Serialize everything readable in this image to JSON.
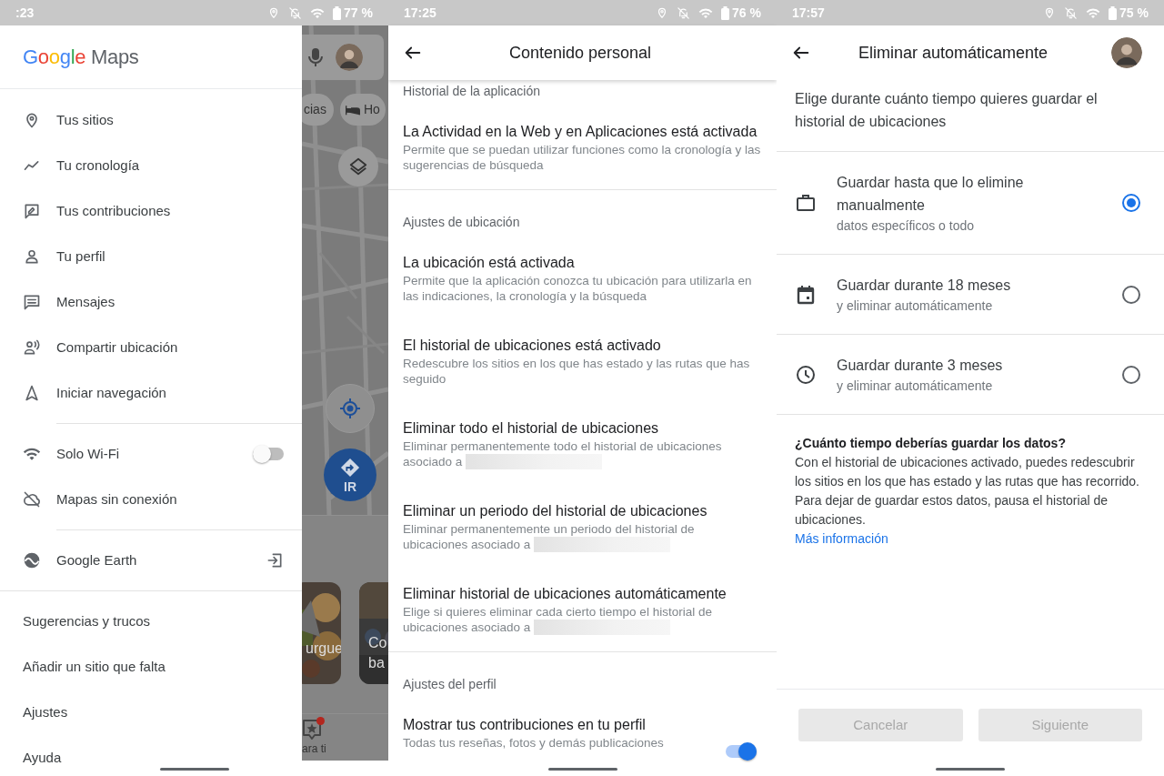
{
  "maps_drawer": {
    "status_bar": {
      "time": ":23",
      "battery": "77 %"
    },
    "logo": {
      "brand": "Google",
      "product": "Maps"
    },
    "groups": [
      {
        "kind": "icons",
        "items": [
          {
            "kind": "link",
            "label": "Tus sitios"
          },
          {
            "kind": "link",
            "label": "Tu cronología"
          },
          {
            "kind": "link",
            "label": "Tus contribuciones"
          },
          {
            "kind": "link",
            "label": "Tu perfil"
          },
          {
            "kind": "link",
            "label": "Mensajes"
          },
          {
            "kind": "link",
            "label": "Compartir ubicación"
          },
          {
            "kind": "link",
            "label": "Iniciar navegación"
          }
        ]
      },
      {
        "kind": "icons",
        "items": [
          {
            "kind": "toggle",
            "label": "Solo Wi-Fi",
            "on": false
          },
          {
            "kind": "link",
            "label": "Mapas sin conexión"
          }
        ]
      },
      {
        "kind": "icons",
        "items": [
          {
            "kind": "external",
            "label": "Google Earth"
          }
        ]
      },
      {
        "kind": "plain",
        "items": [
          {
            "kind": "link",
            "label": "Sugerencias y trucos"
          },
          {
            "kind": "link",
            "label": "Añadir un sitio que falta"
          },
          {
            "kind": "link",
            "label": "Ajustes"
          },
          {
            "kind": "link",
            "label": "Ayuda"
          }
        ]
      }
    ],
    "map": {
      "chips": [
        {
          "label": "cias"
        },
        {
          "label": "Ho"
        }
      ],
      "go_button": "IR",
      "cards": [
        {
          "title": "urgue"
        },
        {
          "title": "Co ba"
        }
      ],
      "nav_label": "ara ti"
    }
  },
  "personal_content": {
    "status_bar": {
      "time": "17:25",
      "battery": "76 %"
    },
    "title": "Contenido personal",
    "sections": [
      {
        "heading": "Historial de la aplicación",
        "items": [
          {
            "kind": "link",
            "title": "La Actividad en la Web y en Aplicaciones está activada",
            "description": "Permite que se puedan utilizar funciones como la cronología y las sugerencias de búsqueda",
            "redacted": false
          }
        ]
      },
      {
        "heading": "Ajustes de ubicación",
        "items": [
          {
            "kind": "link",
            "title": "La ubicación está activada",
            "description": "Permite que la aplicación conozca tu ubicación para utilizarla en las indicaciones, la cronología y la búsqueda",
            "redacted": false
          },
          {
            "kind": "link",
            "title": "El historial de ubicaciones está activado",
            "description": "Redescubre los sitios en los que has estado y las rutas que has seguido",
            "redacted": false
          },
          {
            "kind": "link",
            "title": "Eliminar todo el historial de ubicaciones",
            "description": "Eliminar permanentemente todo el historial de ubicaciones asociado a",
            "redacted": true
          },
          {
            "kind": "link",
            "title": "Eliminar un periodo del historial de ubicaciones",
            "description": "Eliminar permanentemente un periodo del historial de ubicaciones asociado a",
            "redacted": true
          },
          {
            "kind": "link",
            "title": "Eliminar historial de ubicaciones automáticamente",
            "description": "Elige si quieres eliminar cada cierto tiempo el historial de ubicaciones asociado a",
            "redacted": true
          }
        ]
      },
      {
        "heading": "Ajustes del perfil",
        "items": [
          {
            "kind": "toggle",
            "title": "Mostrar tus contribuciones en tu perfil",
            "description": "Todas tus reseñas, fotos y demás publicaciones",
            "redacted": false,
            "on": true
          }
        ]
      }
    ]
  },
  "auto_delete": {
    "status_bar": {
      "time": "17:57",
      "battery": "75 %"
    },
    "title": "Eliminar automáticamente",
    "intro": "Elige durante cuánto tiempo quieres guardar el historial de ubicaciones",
    "options": [
      {
        "title": "Guardar hasta que lo elimine manualmente",
        "subtitle": "datos específicos o todo",
        "selected": true
      },
      {
        "title": "Guardar durante 18 meses",
        "subtitle": "y eliminar automáticamente",
        "selected": false
      },
      {
        "title": "Guardar durante 3 meses",
        "subtitle": "y eliminar automáticamente",
        "selected": false
      }
    ],
    "info": {
      "heading": "¿Cuánto tiempo deberías guardar los datos?",
      "body": "Con el historial de ubicaciones activado, puedes redescubrir los sitios en los que has estado y las rutas que has recorrido. Para dejar de guardar estos datos, pausa el historial de ubicaciones.",
      "link": "Más información"
    },
    "buttons": [
      {
        "label": "Cancelar",
        "disabled": true
      },
      {
        "label": "Siguiente",
        "disabled": true
      }
    ]
  }
}
